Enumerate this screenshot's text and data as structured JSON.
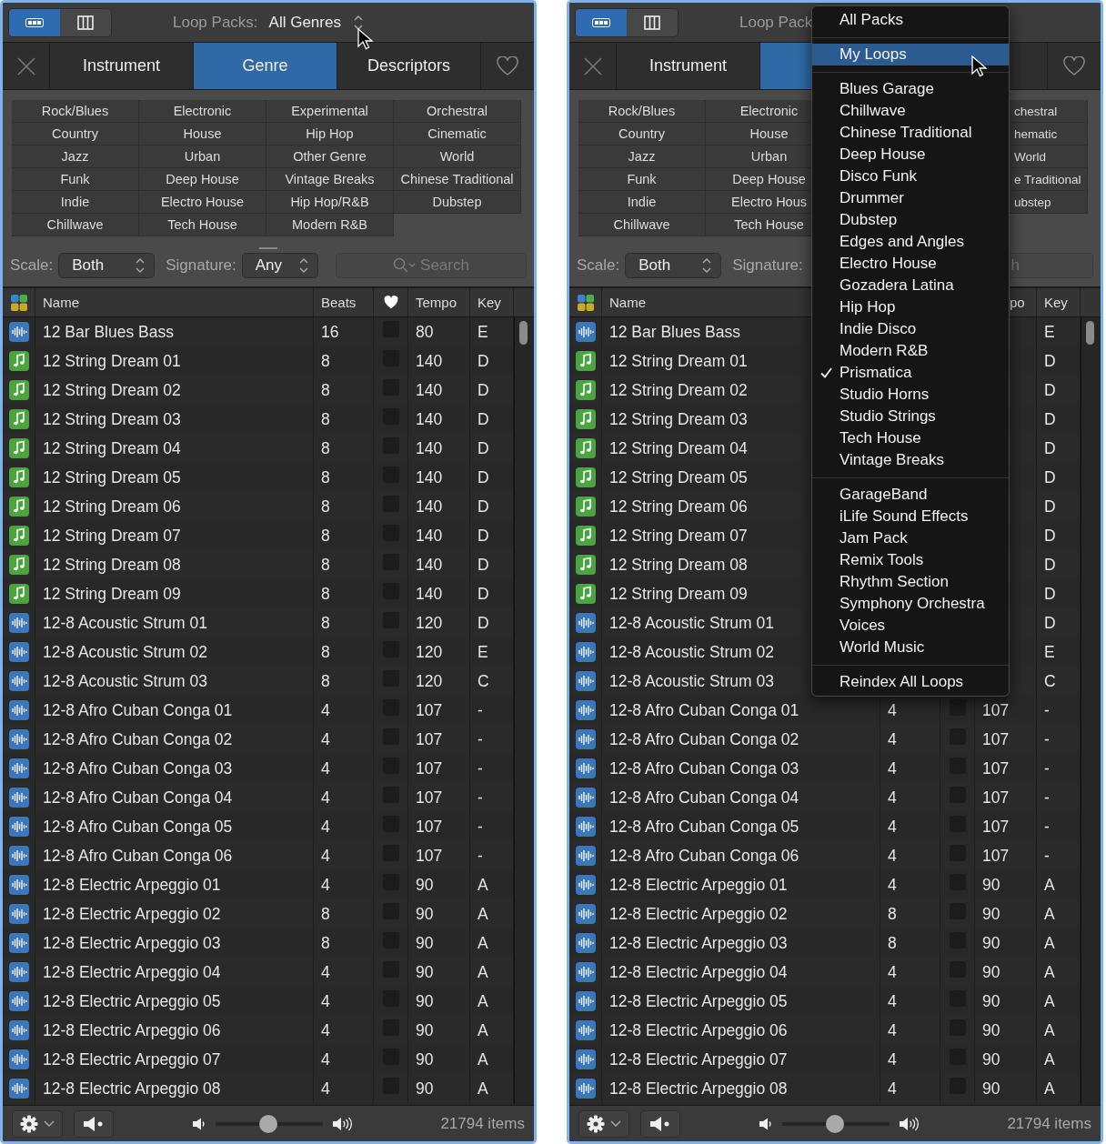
{
  "panels": [
    {
      "views": [
        {
          "kind": "list",
          "selected": true
        },
        {
          "kind": "columns",
          "selected": false
        }
      ],
      "header": {
        "label": "Loop Packs:",
        "value": "All Genres"
      },
      "tabs": [
        {
          "label": "Instrument",
          "selected": false
        },
        {
          "label": "Genre",
          "selected": true
        },
        {
          "label": "Descriptors",
          "selected": false
        }
      ],
      "genre_rows": [
        [
          "Rock/Blues",
          "Electronic",
          "Experimental",
          "Orchestral"
        ],
        [
          "Country",
          "House",
          "Hip Hop",
          "Cinematic"
        ],
        [
          "Jazz",
          "Urban",
          "Other Genre",
          "World"
        ],
        [
          "Funk",
          "Deep House",
          "Vintage Breaks",
          "Chinese Traditional"
        ],
        [
          "Indie",
          "Electro House",
          "Hip Hop/R&B",
          "Dubstep"
        ],
        [
          "Chillwave",
          "Tech House",
          "Modern R&B"
        ]
      ],
      "filters": {
        "scale_label": "Scale:",
        "scale": "Both",
        "signature_label": "Signature:",
        "signature": "Any",
        "search_placeholder": "Search"
      },
      "columns": [
        {
          "kind": "colors"
        },
        {
          "kind": "text",
          "label": "Name"
        },
        {
          "kind": "text",
          "label": "Beats"
        },
        {
          "kind": "heart"
        },
        {
          "kind": "text",
          "label": "Tempo"
        },
        {
          "kind": "text",
          "label": "Key"
        }
      ],
      "rows": [
        {
          "kind": "audio",
          "name": "12 Bar Blues Bass",
          "beats": "16",
          "favorite": false,
          "tempo": "80",
          "key": "E"
        },
        {
          "kind": "midi",
          "name": "12 String Dream 01",
          "beats": "8",
          "favorite": false,
          "tempo": "140",
          "key": "D"
        },
        {
          "kind": "midi",
          "name": "12 String Dream 02",
          "beats": "8",
          "favorite": false,
          "tempo": "140",
          "key": "D"
        },
        {
          "kind": "midi",
          "name": "12 String Dream 03",
          "beats": "8",
          "favorite": false,
          "tempo": "140",
          "key": "D"
        },
        {
          "kind": "midi",
          "name": "12 String Dream 04",
          "beats": "8",
          "favorite": false,
          "tempo": "140",
          "key": "D"
        },
        {
          "kind": "midi",
          "name": "12 String Dream 05",
          "beats": "8",
          "favorite": false,
          "tempo": "140",
          "key": "D"
        },
        {
          "kind": "midi",
          "name": "12 String Dream 06",
          "beats": "8",
          "favorite": false,
          "tempo": "140",
          "key": "D"
        },
        {
          "kind": "midi",
          "name": "12 String Dream 07",
          "beats": "8",
          "favorite": false,
          "tempo": "140",
          "key": "D"
        },
        {
          "kind": "midi",
          "name": "12 String Dream 08",
          "beats": "8",
          "favorite": false,
          "tempo": "140",
          "key": "D"
        },
        {
          "kind": "midi",
          "name": "12 String Dream 09",
          "beats": "8",
          "favorite": false,
          "tempo": "140",
          "key": "D"
        },
        {
          "kind": "audio",
          "name": "12-8 Acoustic Strum 01",
          "beats": "8",
          "favorite": false,
          "tempo": "120",
          "key": "D"
        },
        {
          "kind": "audio",
          "name": "12-8 Acoustic Strum 02",
          "beats": "8",
          "favorite": false,
          "tempo": "120",
          "key": "E"
        },
        {
          "kind": "audio",
          "name": "12-8 Acoustic Strum 03",
          "beats": "8",
          "favorite": false,
          "tempo": "120",
          "key": "C"
        },
        {
          "kind": "audio",
          "name": "12-8 Afro Cuban Conga 01",
          "beats": "4",
          "favorite": false,
          "tempo": "107",
          "key": "-"
        },
        {
          "kind": "audio",
          "name": "12-8 Afro Cuban Conga 02",
          "beats": "4",
          "favorite": false,
          "tempo": "107",
          "key": "-"
        },
        {
          "kind": "audio",
          "name": "12-8 Afro Cuban Conga 03",
          "beats": "4",
          "favorite": false,
          "tempo": "107",
          "key": "-"
        },
        {
          "kind": "audio",
          "name": "12-8 Afro Cuban Conga 04",
          "beats": "4",
          "favorite": false,
          "tempo": "107",
          "key": "-"
        },
        {
          "kind": "audio",
          "name": "12-8 Afro Cuban Conga 05",
          "beats": "4",
          "favorite": false,
          "tempo": "107",
          "key": "-"
        },
        {
          "kind": "audio",
          "name": "12-8 Afro Cuban Conga 06",
          "beats": "4",
          "favorite": false,
          "tempo": "107",
          "key": "-"
        },
        {
          "kind": "audio",
          "name": "12-8 Electric Arpeggio 01",
          "beats": "4",
          "favorite": false,
          "tempo": "90",
          "key": "A"
        },
        {
          "kind": "audio",
          "name": "12-8 Electric Arpeggio 02",
          "beats": "8",
          "favorite": false,
          "tempo": "90",
          "key": "A"
        },
        {
          "kind": "audio",
          "name": "12-8 Electric Arpeggio 03",
          "beats": "8",
          "favorite": false,
          "tempo": "90",
          "key": "A"
        },
        {
          "kind": "audio",
          "name": "12-8 Electric Arpeggio 04",
          "beats": "4",
          "favorite": false,
          "tempo": "90",
          "key": "A"
        },
        {
          "kind": "audio",
          "name": "12-8 Electric Arpeggio 05",
          "beats": "4",
          "favorite": false,
          "tempo": "90",
          "key": "A"
        },
        {
          "kind": "audio",
          "name": "12-8 Electric Arpeggio 06",
          "beats": "4",
          "favorite": false,
          "tempo": "90",
          "key": "A"
        },
        {
          "kind": "audio",
          "name": "12-8 Electric Arpeggio 07",
          "beats": "4",
          "favorite": false,
          "tempo": "90",
          "key": "A"
        },
        {
          "kind": "audio",
          "name": "12-8 Electric Arpeggio 08",
          "beats": "4",
          "favorite": false,
          "tempo": "90",
          "key": "A"
        }
      ],
      "footer": {
        "volume": {
          "level": 0.49
        },
        "count": "21794 items"
      }
    },
    {
      "views": [
        {
          "kind": "list",
          "selected": true
        },
        {
          "kind": "columns",
          "selected": false
        }
      ],
      "header": {
        "label": "Loop Pack"
      },
      "tabs": [
        {
          "label": "Instrument",
          "selected": false
        },
        {
          "selected": true
        },
        {
          "selected": false
        }
      ],
      "genre_rows": [
        [
          "Rock/Blues",
          "Electronic",
          null,
          "chestral"
        ],
        [
          "Country",
          "House",
          null,
          "hematic"
        ],
        [
          "Jazz",
          "Urban",
          null,
          "World"
        ],
        [
          "Funk",
          "Deep House",
          null,
          "e Traditional"
        ],
        [
          "Indie",
          "Electro Hous",
          null,
          "ubstep"
        ],
        [
          "Chillwave",
          "Tech House"
        ]
      ],
      "filters": {
        "scale_label": "Scale:",
        "scale": "Both",
        "signature_label": "Signature:",
        "search_placeholder": "h"
      },
      "columns": [
        {
          "kind": "colors"
        },
        {
          "kind": "text",
          "label": "Name"
        },
        {
          "kind": "blank"
        },
        {
          "kind": "blank"
        },
        {
          "kind": "text",
          "label": "po"
        },
        {
          "kind": "text",
          "label": "Key"
        }
      ],
      "rows": [
        {
          "kind": "audio",
          "name": "12 Bar Blues Bass",
          "key": "E"
        },
        {
          "kind": "midi",
          "name": "12 String Dream 01",
          "key": "D"
        },
        {
          "kind": "midi",
          "name": "12 String Dream 02",
          "key": "D"
        },
        {
          "kind": "midi",
          "name": "12 String Dream 03",
          "key": "D"
        },
        {
          "kind": "midi",
          "name": "12 String Dream 04",
          "key": "D"
        },
        {
          "kind": "midi",
          "name": "12 String Dream 05",
          "key": "D"
        },
        {
          "kind": "midi",
          "name": "12 String Dream 06",
          "key": "D"
        },
        {
          "kind": "midi",
          "name": "12 String Dream 07",
          "key": "D"
        },
        {
          "kind": "midi",
          "name": "12 String Dream 08",
          "key": "D"
        },
        {
          "kind": "midi",
          "name": "12 String Dream 09",
          "key": "D"
        },
        {
          "kind": "audio",
          "name": "12-8 Acoustic Strum 01",
          "key": "D"
        },
        {
          "kind": "audio",
          "name": "12-8 Acoustic Strum 02",
          "key": "E"
        },
        {
          "kind": "audio",
          "name": "12-8 Acoustic Strum 03",
          "key": "C"
        },
        {
          "kind": "audio",
          "name": "12-8 Afro Cuban Conga 01",
          "beats": "4",
          "favorite": false,
          "tempo": "107",
          "key": "-"
        },
        {
          "kind": "audio",
          "name": "12-8 Afro Cuban Conga 02",
          "beats": "4",
          "favorite": false,
          "tempo": "107",
          "key": "-"
        },
        {
          "kind": "audio",
          "name": "12-8 Afro Cuban Conga 03",
          "beats": "4",
          "favorite": false,
          "tempo": "107",
          "key": "-"
        },
        {
          "kind": "audio",
          "name": "12-8 Afro Cuban Conga 04",
          "beats": "4",
          "favorite": false,
          "tempo": "107",
          "key": "-"
        },
        {
          "kind": "audio",
          "name": "12-8 Afro Cuban Conga 05",
          "beats": "4",
          "favorite": false,
          "tempo": "107",
          "key": "-"
        },
        {
          "kind": "audio",
          "name": "12-8 Afro Cuban Conga 06",
          "beats": "4",
          "favorite": false,
          "tempo": "107",
          "key": "-"
        },
        {
          "kind": "audio",
          "name": "12-8 Electric Arpeggio 01",
          "beats": "4",
          "favorite": false,
          "tempo": "90",
          "key": "A"
        },
        {
          "kind": "audio",
          "name": "12-8 Electric Arpeggio 02",
          "beats": "8",
          "favorite": false,
          "tempo": "90",
          "key": "A"
        },
        {
          "kind": "audio",
          "name": "12-8 Electric Arpeggio 03",
          "beats": "8",
          "favorite": false,
          "tempo": "90",
          "key": "A"
        },
        {
          "kind": "audio",
          "name": "12-8 Electric Arpeggio 04",
          "beats": "4",
          "favorite": false,
          "tempo": "90",
          "key": "A"
        },
        {
          "kind": "audio",
          "name": "12-8 Electric Arpeggio 05",
          "beats": "4",
          "favorite": false,
          "tempo": "90",
          "key": "A"
        },
        {
          "kind": "audio",
          "name": "12-8 Electric Arpeggio 06",
          "beats": "4",
          "favorite": false,
          "tempo": "90",
          "key": "A"
        },
        {
          "kind": "audio",
          "name": "12-8 Electric Arpeggio 07",
          "beats": "4",
          "favorite": false,
          "tempo": "90",
          "key": "A"
        },
        {
          "kind": "audio",
          "name": "12-8 Electric Arpeggio 08",
          "beats": "4",
          "favorite": false,
          "tempo": "90",
          "key": "A"
        }
      ],
      "footer": {
        "volume": {
          "level": 0.49
        },
        "count": "21794 items"
      },
      "menu": {
        "groups": [
          [
            {
              "label": "All Packs",
              "selected": false,
              "checked": false
            }
          ],
          [
            {
              "label": "My Loops",
              "selected": true,
              "checked": false
            }
          ],
          [
            {
              "label": "Blues Garage",
              "selected": false,
              "checked": false
            },
            {
              "label": "Chillwave",
              "selected": false,
              "checked": false
            },
            {
              "label": "Chinese Traditional",
              "selected": false,
              "checked": false
            },
            {
              "label": "Deep House",
              "selected": false,
              "checked": false
            },
            {
              "label": "Disco Funk",
              "selected": false,
              "checked": false
            },
            {
              "label": "Drummer",
              "selected": false,
              "checked": false
            },
            {
              "label": "Dubstep",
              "selected": false,
              "checked": false
            },
            {
              "label": "Edges and Angles",
              "selected": false,
              "checked": false
            },
            {
              "label": "Electro House",
              "selected": false,
              "checked": false
            },
            {
              "label": "Gozadera Latina",
              "selected": false,
              "checked": false
            },
            {
              "label": "Hip Hop",
              "selected": false,
              "checked": false
            },
            {
              "label": "Indie Disco",
              "selected": false,
              "checked": false
            },
            {
              "label": "Modern R&B",
              "selected": false,
              "checked": false
            },
            {
              "label": "Prismatica",
              "selected": false,
              "checked": true
            },
            {
              "label": "Studio Horns",
              "selected": false,
              "checked": false
            },
            {
              "label": "Studio Strings",
              "selected": false,
              "checked": false
            },
            {
              "label": "Tech House",
              "selected": false,
              "checked": false
            },
            {
              "label": "Vintage Breaks",
              "selected": false,
              "checked": false
            }
          ],
          [
            {
              "label": "GarageBand",
              "selected": false,
              "checked": false
            },
            {
              "label": "iLife Sound Effects",
              "selected": false,
              "checked": false
            },
            {
              "label": "Jam Pack",
              "selected": false,
              "checked": false
            },
            {
              "label": "Remix Tools",
              "selected": false,
              "checked": false
            },
            {
              "label": "Rhythm Section",
              "selected": false,
              "checked": false
            },
            {
              "label": "Symphony Orchestra",
              "selected": false,
              "checked": false
            },
            {
              "label": "Voices",
              "selected": false,
              "checked": false
            },
            {
              "label": "World Music",
              "selected": false,
              "checked": false
            }
          ],
          [
            {
              "label": "Reindex All Loops",
              "selected": false,
              "checked": false
            }
          ]
        ]
      }
    }
  ]
}
